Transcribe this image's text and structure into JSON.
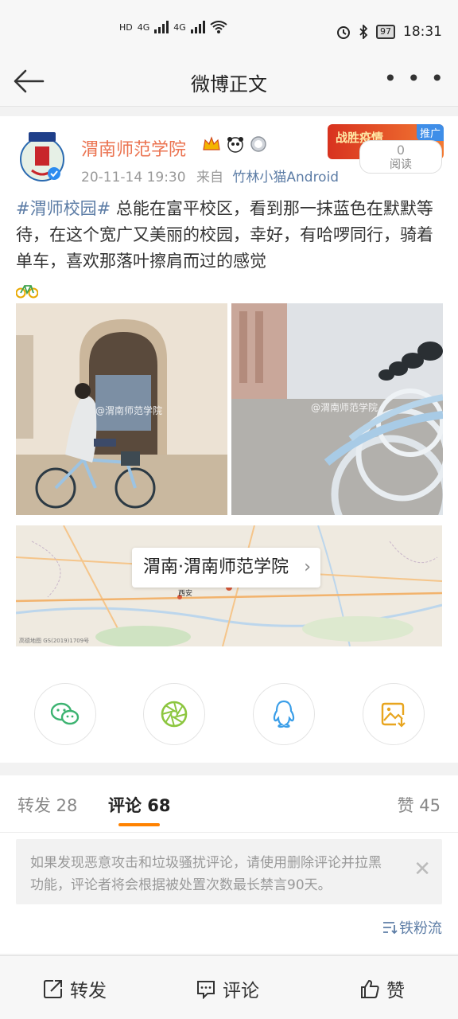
{
  "status_bar": {
    "time": "18:31",
    "battery": "97",
    "network_1": "4G",
    "network_2": "4G"
  },
  "nav": {
    "title": "微博正文"
  },
  "post": {
    "user_name": "渭南师范学院",
    "time": "20-11-14 19:30",
    "source_prefix": "来自",
    "source": "竹林小猫Android",
    "promo_text": "战胜疫情",
    "promo_tag": "推广",
    "read_count": "0",
    "read_label": "阅读",
    "hashtag": "#渭师校园#",
    "text": " 总能在富平校区，看到那一抹蓝色在默默等待，在这个宽广又美丽的校园，幸好，有哈啰同行，骑着单车，喜欢那落叶擦肩而过的感觉",
    "photo1_watermark": "@渭南师范学院",
    "photo2_watermark": "@渭南师范学院",
    "location": "渭南·渭南师范学院",
    "map_footer": "高德地图 GS(2019)1709号",
    "map_city": "西安"
  },
  "tabs": {
    "repost": "转发 28",
    "comment": "评论 68",
    "like": "赞 45"
  },
  "notice": {
    "text": "如果发现恶意攻击和垃圾骚扰评论，请使用删除评论并拉黑功能，评论者将会根据被处置次数最长禁言90天。"
  },
  "sort_label": "铁粉流",
  "bottom_bar": {
    "repost": "转发",
    "comment": "评论",
    "like": "赞"
  },
  "colors": {
    "accent_orange": "#ff8200",
    "link_blue": "#5d7da6",
    "username_orange": "#eb7350"
  }
}
